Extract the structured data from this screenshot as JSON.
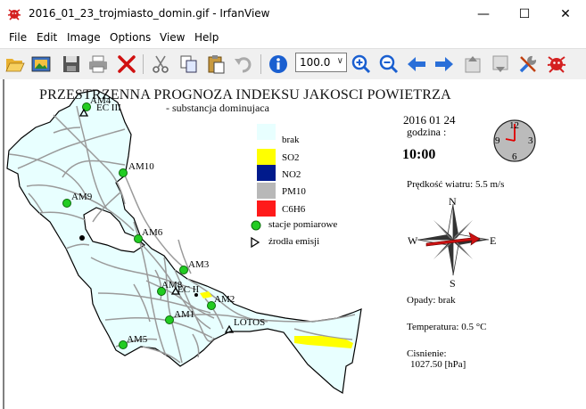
{
  "window": {
    "title": "2016_01_23_trojmiasto_domin.gif - IrfanView",
    "minimize_glyph": "—",
    "maximize_glyph": "☐",
    "close_glyph": "✕",
    "app_icon": "irfanview-cat-icon"
  },
  "menu": {
    "items": [
      "File",
      "Edit",
      "Image",
      "Options",
      "View",
      "Help"
    ]
  },
  "toolbar": {
    "zoom_value": "100.0",
    "zoom_arrow": "∨",
    "icons": [
      "open-folder-icon",
      "slideshow-icon",
      "save-icon",
      "print-icon",
      "delete-icon",
      "cut-icon",
      "copy-icon",
      "paste-icon",
      "undo-icon",
      "info-icon",
      "zoom-in-icon",
      "zoom-out-icon",
      "previous-icon",
      "next-icon",
      "page-up-icon",
      "page-down-icon",
      "settings-icon",
      "irfanview-cat-icon"
    ]
  },
  "map": {
    "title": "PRZESTRZENNA PROGNOZA INDEKSU JAKOSCI POWIETRZA",
    "subtitle": "- substancja dominujaca",
    "date": "2016 01 24",
    "hour_label": "godzina :",
    "hour_value": "10:00",
    "clock_numbers": [
      "12",
      "3",
      "6",
      "9"
    ],
    "wind": "Prędkość wiatru: 5.5 m/s",
    "compass": [
      "N",
      "E",
      "S",
      "W"
    ],
    "precip": "Opady: brak",
    "temperature": "Temperatura: 0.5 °C",
    "pressure_label": "Cisnienie:",
    "pressure_value": "1027.50 [hPa]",
    "legend": [
      {
        "label": "brak",
        "color": "#e8ffff"
      },
      {
        "label": "SO2",
        "color": "#ffff00"
      },
      {
        "label": "NO2",
        "color": "#001a8c"
      },
      {
        "label": "PM10",
        "color": "#b8b8b8"
      },
      {
        "label": "C6H6",
        "color": "#ff1a1a"
      }
    ],
    "legend_stations": "stacje pomiarowe",
    "legend_sources": "źrodła emisji",
    "stations": [
      "AM4",
      "AM10",
      "AM9",
      "AM6",
      "AM3",
      "AM8",
      "AM2",
      "AM1",
      "AM5"
    ],
    "sources": [
      "EC III",
      "EC II",
      "LOTOS"
    ]
  }
}
